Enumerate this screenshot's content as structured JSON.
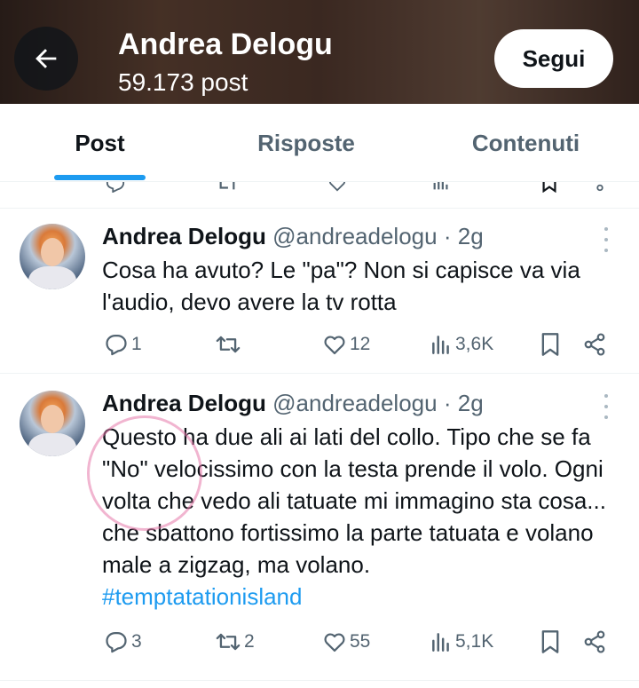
{
  "header": {
    "title": "Andrea Delogu",
    "post_count": "59.173 post",
    "follow_label": "Segui"
  },
  "tabs": [
    {
      "label": "Post",
      "active": true
    },
    {
      "label": "Risposte",
      "active": false
    },
    {
      "label": "Contenuti",
      "active": false
    }
  ],
  "tweets": [
    {
      "name": "Andrea Delogu",
      "handle": "@andreadelogu",
      "time": "2g",
      "text": "Cosa ha avuto? Le \"pa\"? Non si capisce va via l'audio, devo avere la tv rotta",
      "hashtag": "",
      "replies": "1",
      "reposts": "",
      "likes": "12",
      "views": "3,6K"
    },
    {
      "name": "Andrea Delogu",
      "handle": "@andreadelogu",
      "time": "2g",
      "text": "Questo ha due ali ai lati del collo. Tipo che se fa \"No\" velocissimo con la testa prende il volo. Ogni volta che vedo ali tatuate mi immagino sta cosa... che sbattono fortissimo la parte tatuata e volano male a zigzag, ma volano.",
      "hashtag": "#temptatationisland",
      "replies": "3",
      "reposts": "2",
      "likes": "55",
      "views": "5,1K"
    }
  ],
  "icons": {
    "back": "arrow-left-icon",
    "reply": "reply-icon",
    "repost": "repost-icon",
    "like": "heart-icon",
    "views": "views-icon",
    "bookmark": "bookmark-icon",
    "share": "share-icon",
    "more": "more-icon"
  },
  "colors": {
    "accent": "#1d9bf0",
    "text": "#0f1419",
    "muted": "#536471"
  }
}
